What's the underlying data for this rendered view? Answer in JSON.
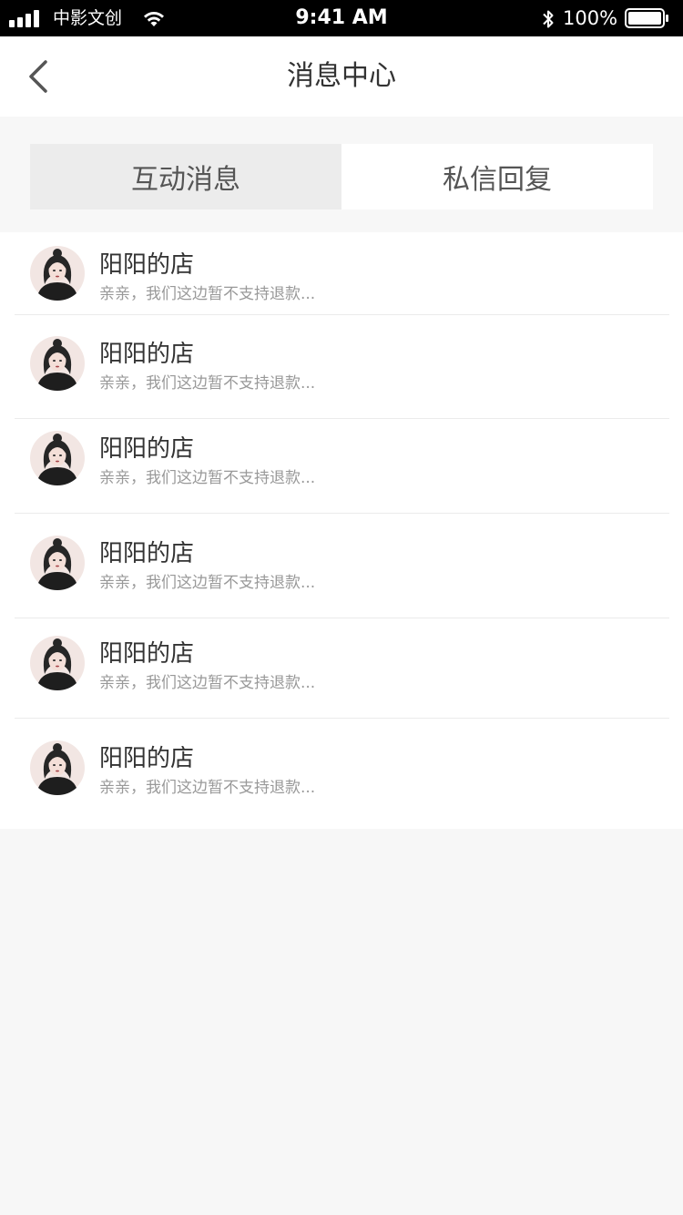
{
  "status_bar": {
    "carrier": "中影文创",
    "time": "9:41 AM",
    "battery_percent": "100%"
  },
  "nav": {
    "title": "消息中心"
  },
  "tabs": [
    {
      "label": "互动消息",
      "active": true
    },
    {
      "label": "私信回复",
      "active": false
    }
  ],
  "messages": [
    {
      "name": "阳阳的店",
      "preview": "亲亲，我们这边暂不支持退款..."
    },
    {
      "name": "阳阳的店",
      "preview": "亲亲，我们这边暂不支持退款..."
    },
    {
      "name": "阳阳的店",
      "preview": "亲亲，我们这边暂不支持退款..."
    },
    {
      "name": "阳阳的店",
      "preview": "亲亲，我们这边暂不支持退款..."
    },
    {
      "name": "阳阳的店",
      "preview": "亲亲，我们这边暂不支持退款..."
    },
    {
      "name": "阳阳的店",
      "preview": "亲亲，我们这边暂不支持退款..."
    }
  ]
}
